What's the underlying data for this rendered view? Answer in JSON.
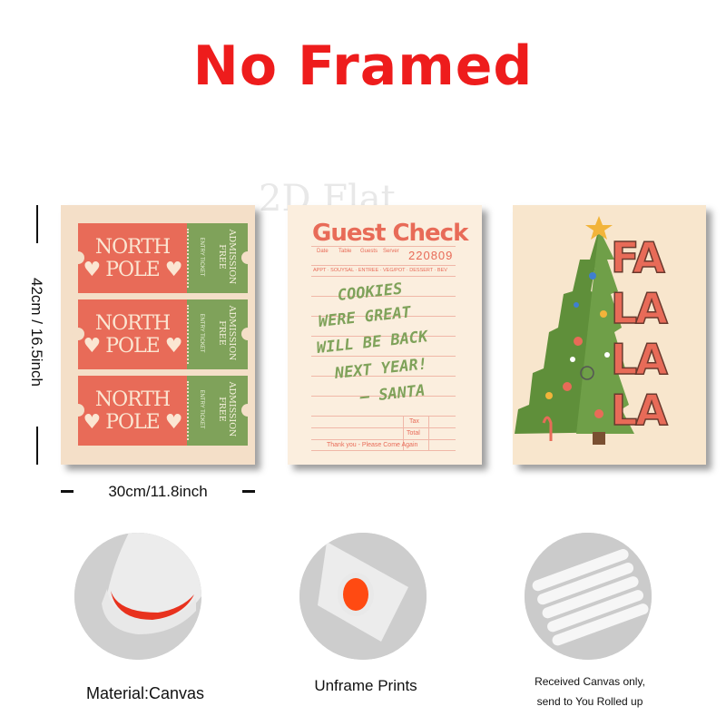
{
  "headline": "No Framed",
  "watermark": "2D Flat",
  "dimensions": {
    "height": "42cm / 16.5inch",
    "width": "30cm/11.8inch"
  },
  "poster1": {
    "tickets": [
      {
        "line1": "NORTH",
        "line2": "♥ POLE ♥",
        "small": "ENTRY TICKET",
        "admission": "ADMISSION FREE"
      },
      {
        "line1": "NORTH",
        "line2": "♥ POLE ♥",
        "small": "ENTRY TICKET",
        "admission": "ADMISSION FREE"
      },
      {
        "line1": "NORTH",
        "line2": "♥ POLE ♥",
        "small": "ENTRY TICKET",
        "admission": "ADMISSION FREE"
      }
    ]
  },
  "poster2": {
    "title": "Guest Check",
    "headers": [
      "Date",
      "Table",
      "Guests",
      "Server"
    ],
    "number": "220809",
    "columns": "APPT · SOUYSAL · ENTREE · VEG/POT · DESSERT · BEV",
    "note": [
      "COOKIES",
      "WERE GREAT",
      "WILL BE BACK",
      "NEXT YEAR!",
      "– SANTA"
    ],
    "tax": "Tax",
    "total": "Total",
    "thanks": "Thank you - Please Come Again"
  },
  "poster3": {
    "rows": [
      "FA",
      "LA",
      "LA",
      "LA"
    ]
  },
  "features": [
    {
      "caption": "Material:Canvas"
    },
    {
      "caption": "Unframe  Prints"
    },
    {
      "caption_line1": "Received Canvas only,",
      "caption_line2": "send to You Rolled up"
    }
  ],
  "colors": {
    "headline": "#ee1c1c",
    "coral": "#e86b58",
    "green": "#7fa25a",
    "cream": "#f4dfc8"
  }
}
